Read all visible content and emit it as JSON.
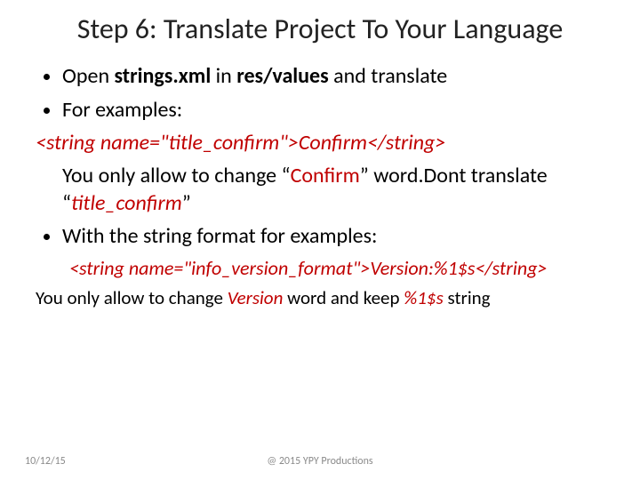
{
  "title": "Step 6: Translate Project To Your Language",
  "bullets": {
    "b1_pre": "Open ",
    "b1_strong1": "strings.xml",
    "b1_mid": " in ",
    "b1_strong2": "res/values",
    "b1_post": " and translate",
    "b2": "For examples:",
    "b3": "With the string format for examples:"
  },
  "code1": "<string name=\"title_confirm\">Confirm</string>",
  "note1_pre": "You only allow to change “",
  "note1_word": "Confirm",
  "note1_mid": "” word.Dont translate “",
  "note1_attr": "title_confirm",
  "note1_post": "”",
  "code2": "<string name=\"info_version_format\">Version:%1$s</string>",
  "note2_pre": "You only allow to change ",
  "note2_word": "Version",
  "note2_mid": " word and keep ",
  "note2_token": "%1$s",
  "note2_post": " string",
  "footer": {
    "date": "10/12/15",
    "copyright": "@ 2015 YPY Productions"
  }
}
